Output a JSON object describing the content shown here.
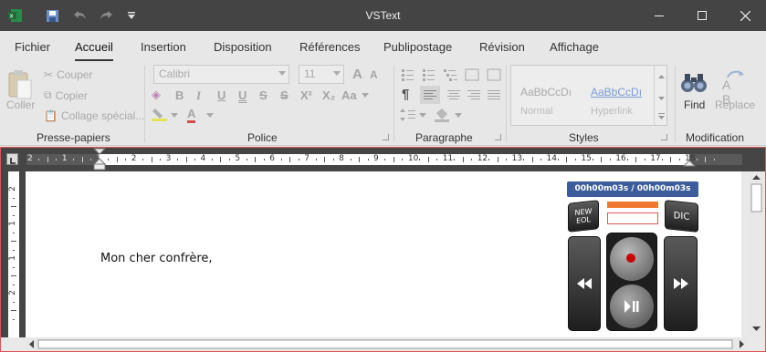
{
  "window": {
    "title": "VSText"
  },
  "tabs": [
    {
      "label": "Fichier"
    },
    {
      "label": "Accueil"
    },
    {
      "label": "Insertion"
    },
    {
      "label": "Disposition"
    },
    {
      "label": "Références"
    },
    {
      "label": "Publipostage"
    },
    {
      "label": "Révision"
    },
    {
      "label": "Affichage"
    }
  ],
  "ribbon": {
    "clipboard": {
      "group_label": "Presse-papiers",
      "paste_label": "Coller",
      "cut_label": "Couper",
      "copy_label": "Copier",
      "paste_special_label": "Collage spécial..."
    },
    "font": {
      "group_label": "Police",
      "font_name": "Calibri",
      "font_size": "11",
      "bold": "B",
      "italic": "I",
      "underline": "U",
      "double_underline": "U",
      "strike": "S",
      "double_strike": "S",
      "superscript": "X²",
      "subscript": "X₂",
      "change_case": "Aa",
      "grow_font": "A",
      "shrink_font": "A",
      "font_color": "A"
    },
    "paragraph": {
      "group_label": "Paragraphe",
      "pilcrow": "¶"
    },
    "styles": {
      "group_label": "Styles",
      "preview": "AaBbCcDı",
      "normal_label": "Normal",
      "hyperlink_label": "Hyperlink"
    },
    "editing": {
      "group_label": "Modification",
      "find_label": "Find",
      "replace_label": "Replace",
      "replace_glyph": "A B"
    }
  },
  "ruler": {
    "labels": [
      "2",
      "1",
      "1",
      "2",
      "3",
      "4",
      "5",
      "6",
      "7",
      "8",
      "9",
      "10",
      "11",
      "12",
      "13",
      "14",
      "15",
      "16",
      "17",
      "18"
    ]
  },
  "vruler": {
    "labels": [
      "2",
      "1",
      "1",
      "2"
    ]
  },
  "document": {
    "text": "Mon cher confrère,"
  },
  "player": {
    "time": "00h00m03s / 00h00m03s",
    "new_eol_label": "NEW\nEOL",
    "dic_label": "DIC"
  },
  "colors": {
    "titlebar": "#444444",
    "accent_timebar": "#3d5c9b",
    "progress": "#f07830",
    "selection_frame": "#e05555"
  }
}
